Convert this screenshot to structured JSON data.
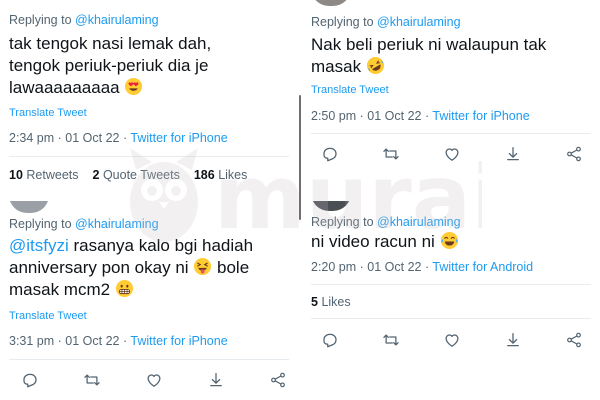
{
  "watermark": {
    "text": "murai"
  },
  "tweets": [
    {
      "replying_to_prefix": "Replying to ",
      "replying_to_handle": "@khairulaming",
      "text_line1": "tak tengok nasi lemak dah,",
      "text_line2": "tengok periuk-periuk dia je",
      "text_line3": "lawaaaaaaaaa",
      "emoji": "smiling-face-with-heart-eyes",
      "translate": "Translate Tweet",
      "time": "2:34 pm · 01 Oct 22",
      "source": "Twitter for iPhone",
      "retweets_count": "10",
      "retweets_label": "Retweets",
      "quotes_count": "2",
      "quotes_label": "Quote Tweets",
      "likes_count": "186",
      "likes_label": "Likes"
    },
    {
      "replying_to_prefix": "Replying to ",
      "replying_to_handle": "@khairulaming",
      "mention": "@itsfyzi",
      "text_line1": " rasanya kalo bgi hadiah",
      "text_line2": "anniversary pon okay ni",
      "text_line2_after": "bole",
      "text_line3": "masak mcm2",
      "emoji1": "face-with-stuck-out-tongue-and-tightly-closed-eyes",
      "emoji2": "grimacing-face",
      "translate": "Translate Tweet",
      "time": "3:31 pm · 01 Oct 22",
      "source": "Twitter for iPhone"
    },
    {
      "replying_to_prefix": "Replying to ",
      "replying_to_handle": "@khairulaming",
      "text_line1": "Nak beli periuk ni walaupun tak",
      "text_line2": "masak",
      "emoji": "rolling-on-the-floor-laughing",
      "translate": "Translate Tweet",
      "time": "2:50 pm · 01 Oct 22",
      "source": "Twitter for iPhone"
    },
    {
      "replying_to_prefix": "Replying to ",
      "replying_to_handle": "@khairulaming",
      "text_line1": "ni video racun ni",
      "emoji": "face-with-tears-of-joy",
      "time": "2:20 pm · 01 Oct 22",
      "source": "Twitter for Android",
      "likes_count": "5",
      "likes_label": "Likes"
    }
  ],
  "actions": {
    "icons": [
      "reply-icon",
      "retweet-icon",
      "like-icon",
      "bookmark-icon",
      "share-icon"
    ]
  },
  "colors": {
    "link": "#1d9bf0",
    "secondary_text": "#536471",
    "primary_text": "#0f1419",
    "divider": "#e6ecf0",
    "watermark": "#c9bfc4"
  }
}
